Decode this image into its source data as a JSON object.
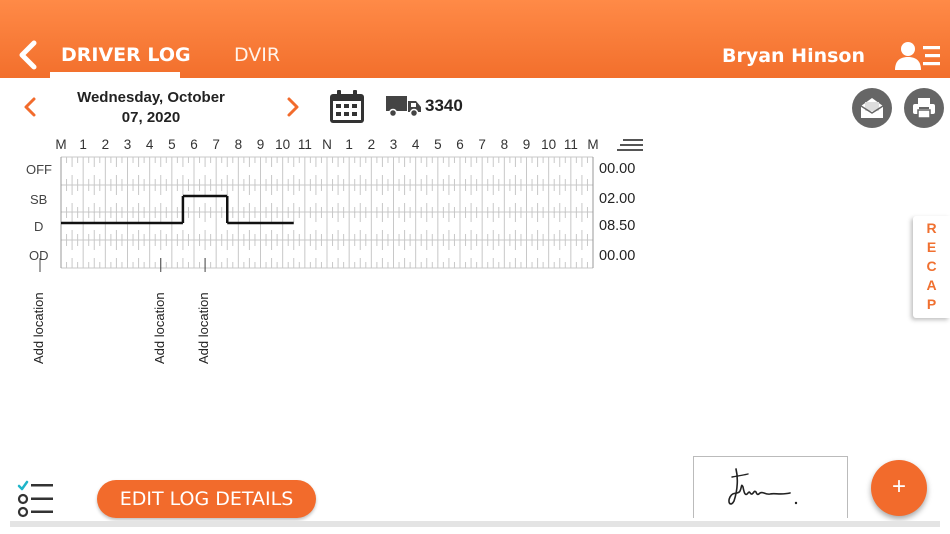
{
  "header": {
    "tabs": [
      {
        "label": "DRIVER LOG",
        "active": true
      },
      {
        "label": "DVIR",
        "active": false
      }
    ],
    "user_name": "Bryan Hinson",
    "accent_color": "#f26b2c"
  },
  "date_bar": {
    "date_line1": "Wednesday, October",
    "date_line2": "07, 2020",
    "truck_number": "3340"
  },
  "log_grid": {
    "hour_labels": [
      "M",
      "1",
      "2",
      "3",
      "4",
      "5",
      "6",
      "7",
      "8",
      "9",
      "10",
      "11",
      "N",
      "1",
      "2",
      "3",
      "4",
      "5",
      "6",
      "7",
      "8",
      "9",
      "10",
      "11",
      "M"
    ],
    "statuses": [
      {
        "label": "OFF",
        "total": "00.00"
      },
      {
        "label": "SB",
        "total": "02.00"
      },
      {
        "label": "D",
        "total": "08.50"
      },
      {
        "label": "OD",
        "total": "00.00"
      }
    ],
    "segments": [
      {
        "status": "D",
        "start_hour": 0,
        "end_hour": 5.5
      },
      {
        "status": "SB",
        "start_hour": 5.5,
        "end_hour": 7.5
      },
      {
        "status": "D",
        "start_hour": 7.5,
        "end_hour": 10.5
      }
    ],
    "location_markers": [
      {
        "hour": -1,
        "label": "Add location"
      },
      {
        "hour": 4.5,
        "label": "Add location"
      },
      {
        "hour": 6.5,
        "label": "Add location"
      }
    ]
  },
  "recap_label": [
    "R",
    "E",
    "C",
    "A",
    "P"
  ],
  "footer": {
    "edit_button_label": "EDIT LOG DETAILS",
    "fab_label": "+"
  }
}
